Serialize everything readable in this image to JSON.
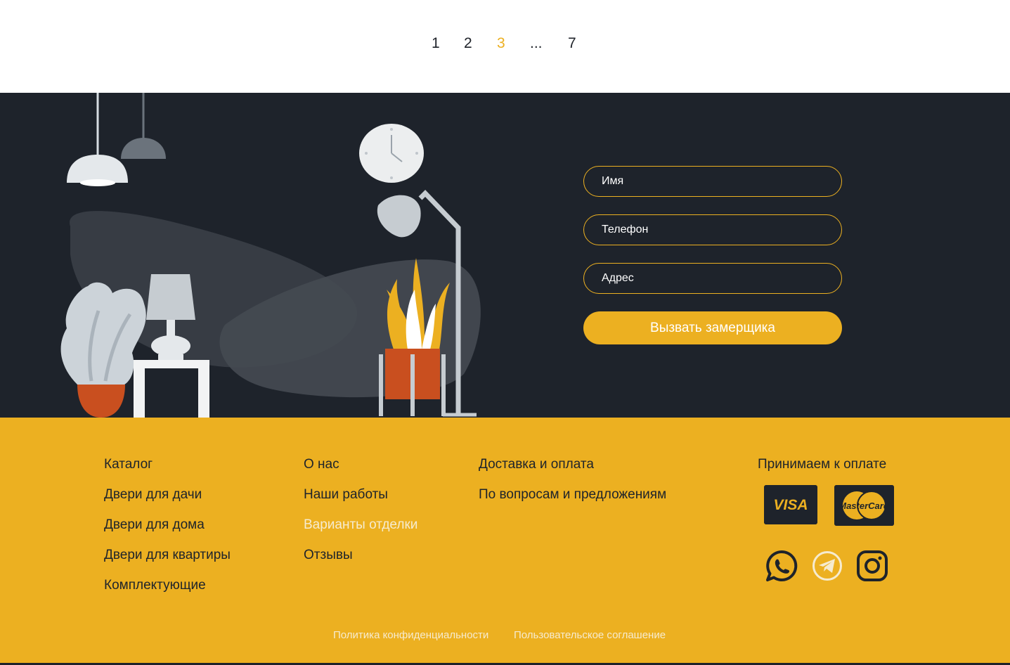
{
  "pagination": {
    "pages": [
      "1",
      "2",
      "3",
      "...",
      "7"
    ],
    "current": "3"
  },
  "form": {
    "name_placeholder": "Имя",
    "phone_placeholder": "Телефон",
    "address_placeholder": "Адрес",
    "submit_label": "Вызвать замерщика"
  },
  "footer": {
    "col1": [
      "Каталог",
      "Двери для дачи",
      "Двери для дома",
      "Двери для квартиры",
      "Комплектующие"
    ],
    "col2": [
      "О нас",
      "Наши работы",
      "Варианты отделки",
      "Отзывы"
    ],
    "col3": [
      "Доставка и оплата",
      "По вопросам и предложениям"
    ],
    "payment_title": "Принимаем к оплате",
    "cards": {
      "visa": "VISA",
      "mastercard": "MasterCard"
    },
    "social": [
      "whatsapp-icon",
      "telegram-icon",
      "instagram-icon"
    ],
    "legal": {
      "privacy": "Политика конфиденциальности",
      "terms": "Пользовательское соглашение"
    }
  },
  "colors": {
    "accent": "#ecb021",
    "dark": "#1e232b",
    "pale": "#f6ebcf",
    "pot": "#c94f1f"
  }
}
